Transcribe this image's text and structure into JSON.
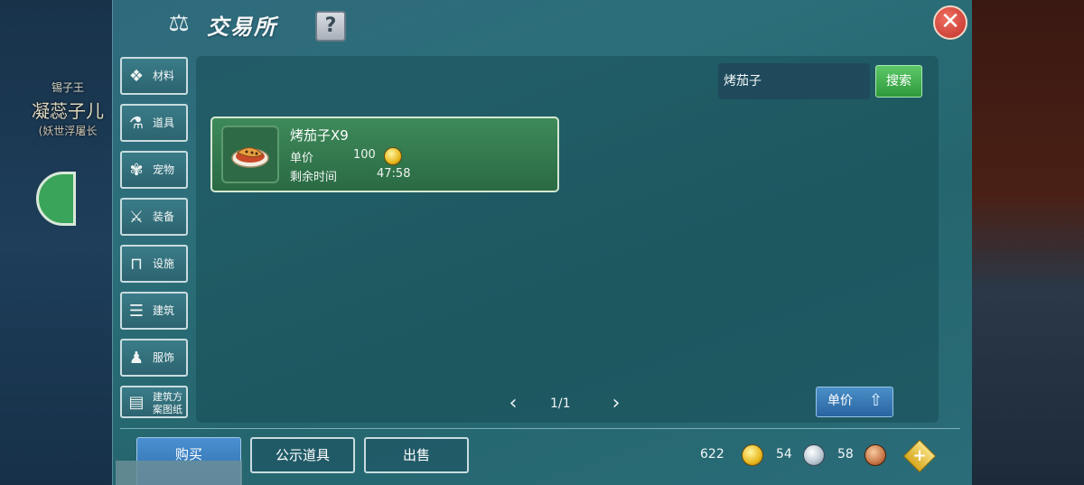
{
  "background": {
    "npc_title": "锡子王",
    "npc_name": "凝蕊子儿",
    "npc_sub": "(妖世浮屠长"
  },
  "header": {
    "title": "交易所",
    "scale_icon": "scale-icon",
    "help_label": "?",
    "close_label": "✕"
  },
  "sidebar": {
    "items": [
      {
        "label": "材料",
        "icon": "material-icon",
        "glyph": "❖"
      },
      {
        "label": "道具",
        "icon": "flask-icon",
        "glyph": "⚗"
      },
      {
        "label": "宠物",
        "icon": "paw-icon",
        "glyph": "✾"
      },
      {
        "label": "装备",
        "icon": "sword-shield-icon",
        "glyph": "⚔"
      },
      {
        "label": "设施",
        "icon": "table-icon",
        "glyph": "⊓"
      },
      {
        "label": "建筑",
        "icon": "building-icon",
        "glyph": "☰"
      },
      {
        "label": "服饰",
        "icon": "clothes-icon",
        "glyph": "♟"
      },
      {
        "label": "建筑方案图纸",
        "line1": "建筑方",
        "line2": "案图纸",
        "icon": "blueprint-icon",
        "glyph": "▤"
      }
    ]
  },
  "search": {
    "value": "烤茄子",
    "button_label": "搜索"
  },
  "listing": {
    "name": "烤茄子X9",
    "price_label": "单价",
    "price_value": "100",
    "time_label": "剩余时间",
    "time_value": "47:58",
    "icon": "roasted-eggplant-icon"
  },
  "pager": {
    "text": "1/1",
    "prev": "‹",
    "next": "›"
  },
  "sort": {
    "label": "单价",
    "arrow": "⇧"
  },
  "bottom_tabs": {
    "buy": "购买",
    "display": "公示道具",
    "sell": "出售"
  },
  "currency": {
    "gold": "622",
    "silver": "54",
    "copper": "58",
    "add_label": "+"
  }
}
